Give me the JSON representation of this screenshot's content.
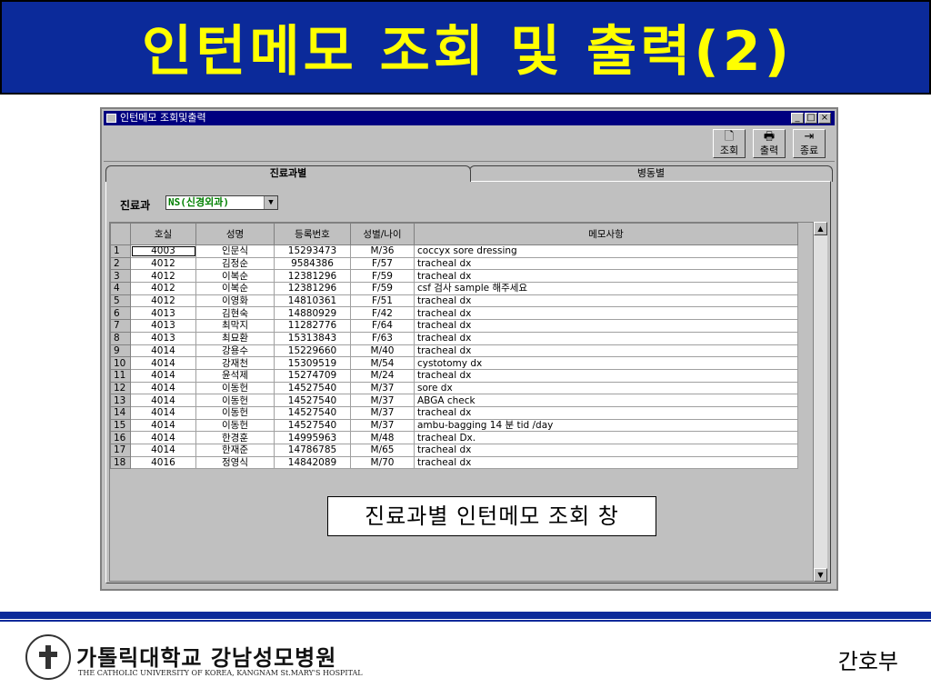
{
  "slide_title": "인턴메모 조회 및 출력(2)",
  "window": {
    "title": "인턴메모 조회및출력",
    "buttons": [
      "_",
      "□",
      "×"
    ]
  },
  "toolbar": {
    "search": {
      "label": "조회",
      "icon": "search-doc-icon"
    },
    "print": {
      "label": "출력",
      "icon": "printer-icon"
    },
    "exit": {
      "label": "종료",
      "icon": "exit-door-icon"
    }
  },
  "tabs": [
    "진료과별",
    "병동별"
  ],
  "filter": {
    "label": "진료과",
    "value": "NS(신경외과)"
  },
  "grid": {
    "columns": [
      "호실",
      "성명",
      "등록번호",
      "성별/나이",
      "메모사항"
    ],
    "rows": [
      [
        "1",
        "4003",
        "인문식",
        "15293473",
        "M/36",
        "coccyx sore dressing"
      ],
      [
        "2",
        "4012",
        "김정순",
        "9584386",
        "F/57",
        "tracheal dx"
      ],
      [
        "3",
        "4012",
        "이복순",
        "12381296",
        "F/59",
        "tracheal dx"
      ],
      [
        "4",
        "4012",
        "이복순",
        "12381296",
        "F/59",
        "csf 검사 sample 해주세요"
      ],
      [
        "5",
        "4012",
        "이영화",
        "14810361",
        "F/51",
        "tracheal dx"
      ],
      [
        "6",
        "4013",
        "김현숙",
        "14880929",
        "F/42",
        "tracheal dx"
      ],
      [
        "7",
        "4013",
        "최막지",
        "11282776",
        "F/64",
        "tracheal dx"
      ],
      [
        "8",
        "4013",
        "최묘환",
        "15313843",
        "F/63",
        "tracheal dx"
      ],
      [
        "9",
        "4014",
        "강용수",
        "15229660",
        "M/40",
        "tracheal dx"
      ],
      [
        "10",
        "4014",
        "강재천",
        "15309519",
        "M/54",
        "cystotomy dx"
      ],
      [
        "11",
        "4014",
        "윤석제",
        "15274709",
        "M/24",
        "tracheal dx"
      ],
      [
        "12",
        "4014",
        "이동헌",
        "14527540",
        "M/37",
        "sore dx"
      ],
      [
        "13",
        "4014",
        "이동헌",
        "14527540",
        "M/37",
        "ABGA check"
      ],
      [
        "14",
        "4014",
        "이동헌",
        "14527540",
        "M/37",
        "tracheal dx"
      ],
      [
        "15",
        "4014",
        "이동헌",
        "14527540",
        "M/37",
        "ambu-bagging 14 분 tid /day"
      ],
      [
        "16",
        "4014",
        "한경훈",
        "14995963",
        "M/48",
        "tracheal Dx."
      ],
      [
        "17",
        "4014",
        "한재준",
        "14786785",
        "M/65",
        "tracheal dx"
      ],
      [
        "18",
        "4016",
        "정영식",
        "14842089",
        "M/70",
        "tracheal dx"
      ]
    ]
  },
  "caption": "진료과별 인턴메모 조회 창",
  "footer": {
    "logo_ko": "가톨릭대학교 강남성모병원",
    "logo_en": "THE CATHOLIC UNIVERSITY OF KOREA, KANGNAM St.MARY'S HOSPITAL",
    "department": "간호부"
  },
  "colors": {
    "title_bg": "#0b2a9a",
    "title_text": "#ffff00",
    "window_title": "#000080"
  }
}
